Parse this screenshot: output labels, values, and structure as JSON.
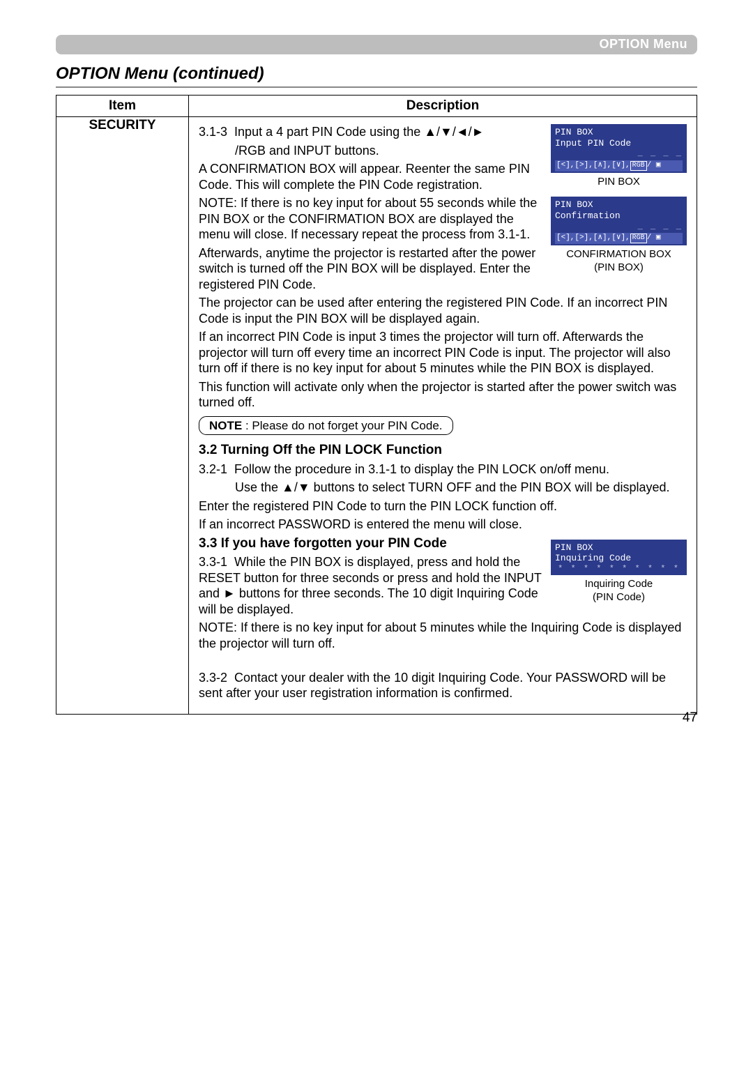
{
  "header": {
    "top_bar_label": "OPTION Menu",
    "section_title": "OPTION Menu (continued)"
  },
  "table": {
    "col_item": "Item",
    "col_desc": "Description",
    "item_value": "SECURITY"
  },
  "body": {
    "p313_lead": "3.1-3",
    "p313_a": "Input a 4 part PIN Code using the ▲/▼/◄/►",
    "p313_b": "/RGB and INPUT buttons.",
    "p_conf1": "A CONFIRMATION BOX will appear. Reenter the same PIN Code. This will complete the PIN Code registration.",
    "p_conf2": "NOTE: If there is no key input for about 55 seconds while the PIN BOX or the CONFIRMATION BOX are displayed the menu will close. If necessary repeat the process from 3.1-1.",
    "p_after1": "Afterwards, anytime the projector is restarted after the power switch is turned off the PIN BOX will be displayed. Enter the registered PIN Code.",
    "p_after2": "The projector can be used after entering the registered PIN Code. If an incorrect PIN Code is input the PIN BOX will be displayed again.",
    "p_after3": "If an incorrect PIN Code is input 3 times the projector will turn off. Afterwards the projector will turn off every time an incorrect PIN Code is input. The projector will also turn off if there is no key input for about 5 minutes while the PIN BOX is displayed.",
    "p_after4": "This function will activate only when the projector is started after the power switch was turned off.",
    "note_label": "NOTE",
    "note_text": " : Please do not forget your PIN Code.",
    "h32": "3.2 Turning Off the PIN LOCK Function",
    "p321_lead": "3.2-1",
    "p321_a": "Follow the procedure in 3.1-1 to display the PIN LOCK on/off menu.",
    "p321_b": "Use the ▲/▼ buttons to select TURN OFF and the PIN BOX will be displayed.",
    "p_32c": "Enter the registered PIN Code to turn the PIN LOCK function off.",
    "p_32d": "If an incorrect PASSWORD is entered the  menu will close.",
    "h33": "3.3 If you have forgotten your PIN Code",
    "p331_lead": "3.3-1",
    "p331_a": "While the PIN BOX is displayed, press and hold the RESET button for three seconds or press and hold the INPUT and ► buttons for three seconds. The 10 digit Inquiring Code will be displayed.",
    "p331_note": "NOTE: If there is no key input for about 5 minutes while the Inquiring Code is displayed the projector will turn off.",
    "p332_lead": "3.3-2",
    "p332_a": "Contact your dealer with the 10 digit Inquiring Code. Your PASSWORD will be sent after your user registration information is confirmed."
  },
  "ui_boxes": {
    "pinbox_title": "PIN BOX",
    "input_pin": "Input PIN Code",
    "dashes": "_ _ _ _",
    "icons_row": "[<],[>],[∧],[∨],",
    "rgb": "RGB",
    "slash_play": "/ ▣",
    "caption_pinbox": "PIN BOX",
    "confirmation": "Confirmation",
    "caption_conf1": "CONFIRMATION BOX",
    "caption_conf2": "(PIN BOX)",
    "inquiring": "Inquiring Code",
    "inquiring_stars": "* *  * * * *  * * * *",
    "caption_inq1": "Inquiring Code",
    "caption_inq2": "(PIN Code)"
  },
  "page_number": "47"
}
